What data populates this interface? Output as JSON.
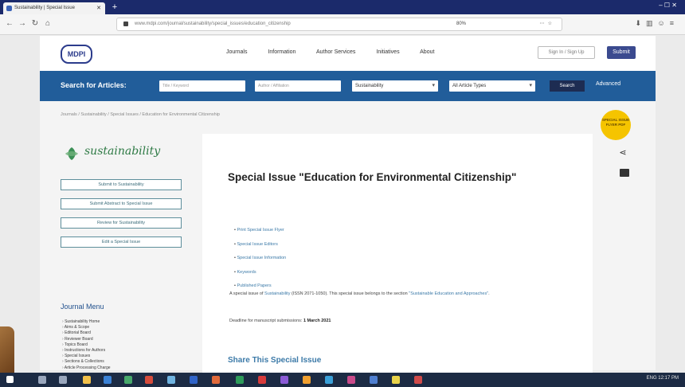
{
  "browser": {
    "tab_title": "Sustainability | Special Issue",
    "new_tab": "+",
    "window_controls": "–  ☐  ✕",
    "url": "www.mdpi.com/journal/sustainability/special_issues/education_citizenship",
    "zoom": "80%"
  },
  "header": {
    "logo": "MDPI",
    "nav": [
      "Journals",
      "Information",
      "Author Services",
      "Initiatives",
      "About"
    ],
    "signin": "Sign In / Sign Up",
    "submit": "Submit"
  },
  "search": {
    "label": "Search for Articles:",
    "title_placeholder": "Title / Keyword",
    "author_placeholder": "Author / Affiliation",
    "journal": "Sustainability",
    "article_type": "All Article Types",
    "button": "Search",
    "advanced": "Advanced"
  },
  "breadcrumb": "Journals  /  Sustainability  /  Special Issues  /  Education for Environmental Citizenship",
  "sidebar": {
    "journal_name": "sustainability",
    "buttons": [
      "Submit to Sustainability",
      "Submit Abstract to Special Issue",
      "Review for Sustainability",
      "Edit a Special Issue"
    ],
    "menu_title": "Journal Menu",
    "menu_items": [
      "Sustainability Home",
      "Aims & Scope",
      "Editorial Board",
      "Reviewer Board",
      "Topics Board",
      "Instructions for Authors",
      "Special Issues",
      "Sections & Collections",
      "Article Processing Charge"
    ]
  },
  "main": {
    "title": "Special Issue \"Education for Environmental Citizenship\"",
    "links": [
      "Print Special Issue Flyer",
      "Special Issue Editors",
      "Special Issue Information",
      "Keywords",
      "Published Papers"
    ],
    "info_text": "A special issue of ",
    "info_journal": "Sustainability",
    "info_rest": " (ISSN 2071-1050). This special issue belongs to the section ",
    "info_section": "\"Sustainable Education and Approaches\"",
    "info_end": ".",
    "deadline_label": "Deadline for manuscript submissions: ",
    "deadline_value": "1 March 2021",
    "share_title": "Share This Special Issue"
  },
  "rail": {
    "badge": "SPECIAL ISSUE FLYER PDF",
    "share_icon": "share-icon",
    "comment_icon": "comment-icon"
  },
  "taskbar": {
    "tray": "ENG  12:17 PM"
  },
  "colors": {
    "searchbar": "#215d9a",
    "tabbar": "#1b2a6b",
    "link": "#3c7aa8",
    "badge": "#f5c400",
    "journal_green": "#2e7a45"
  }
}
